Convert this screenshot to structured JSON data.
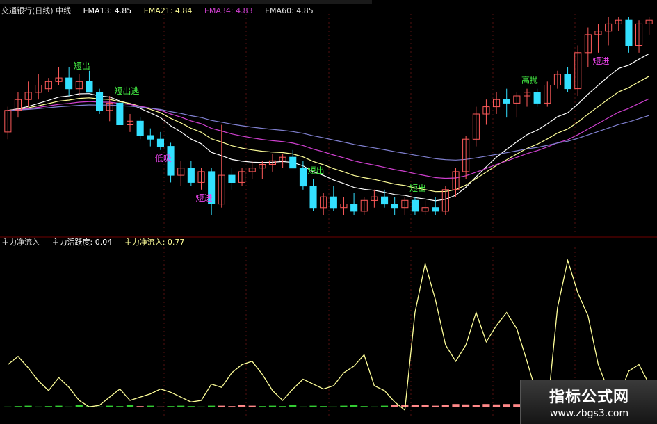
{
  "header": {
    "stock": "交通银行(日线)",
    "mode": "中线",
    "ema13": "EMA13: 4.85",
    "ema21": "EMA21: 4.84",
    "ema34": "EMA34: 4.83",
    "ema60": "EMA60: 4.85"
  },
  "indicator_header": {
    "name": "主力净流入",
    "activity": "主力活跃度: 0.04",
    "net_inflow": "主力净流入: 0.77"
  },
  "watermark": {
    "title": "指标公式网",
    "url": "www.zbgs3.com"
  },
  "colors": {
    "up": "#ff5a5a",
    "down": "#33e0ff",
    "ema13": "#ffffff",
    "ema21": "#ffff99",
    "ema34": "#d040d0",
    "ema60": "#8080d0",
    "flow": "#ffff99",
    "signal_green": "#44ee44",
    "signal_magenta": "#ee44ee"
  },
  "chart_data": [
    {
      "type": "candlestick",
      "title": "",
      "x_count": 64,
      "ylim": [
        4.6,
        5.2
      ],
      "candles": [
        [
          4.88,
          4.95,
          4.86,
          4.94
        ],
        [
          4.94,
          4.99,
          4.92,
          4.97
        ],
        [
          4.97,
          5.02,
          4.95,
          4.99
        ],
        [
          4.99,
          5.04,
          4.97,
          5.01
        ],
        [
          5.0,
          5.03,
          4.99,
          5.02
        ],
        [
          5.02,
          5.06,
          5.01,
          5.03
        ],
        [
          5.03,
          5.06,
          4.98,
          5.0
        ],
        [
          5.0,
          5.04,
          4.98,
          5.02
        ],
        [
          5.02,
          5.05,
          4.99,
          4.99
        ],
        [
          4.99,
          5.0,
          4.93,
          4.94
        ],
        [
          4.94,
          4.98,
          4.91,
          4.96
        ],
        [
          4.96,
          4.97,
          4.9,
          4.9
        ],
        [
          4.9,
          4.93,
          4.88,
          4.91
        ],
        [
          4.91,
          4.92,
          4.86,
          4.87
        ],
        [
          4.87,
          4.89,
          4.84,
          4.86
        ],
        [
          4.86,
          4.88,
          4.83,
          4.84
        ],
        [
          4.84,
          4.85,
          4.74,
          4.76
        ],
        [
          4.76,
          4.8,
          4.73,
          4.78
        ],
        [
          4.78,
          4.8,
          4.73,
          4.74
        ],
        [
          4.74,
          4.78,
          4.72,
          4.77
        ],
        [
          4.77,
          4.78,
          4.65,
          4.68
        ],
        [
          4.68,
          4.9,
          4.67,
          4.76
        ],
        [
          4.76,
          4.78,
          4.72,
          4.74
        ],
        [
          4.74,
          4.78,
          4.73,
          4.77
        ],
        [
          4.77,
          4.8,
          4.75,
          4.78
        ],
        [
          4.78,
          4.8,
          4.75,
          4.79
        ],
        [
          4.79,
          4.82,
          4.77,
          4.8
        ],
        [
          4.8,
          4.82,
          4.78,
          4.81
        ],
        [
          4.81,
          4.83,
          4.78,
          4.78
        ],
        [
          4.78,
          4.8,
          4.72,
          4.73
        ],
        [
          4.73,
          4.75,
          4.66,
          4.67
        ],
        [
          4.67,
          4.71,
          4.65,
          4.7
        ],
        [
          4.7,
          4.73,
          4.66,
          4.67
        ],
        [
          4.67,
          4.7,
          4.65,
          4.68
        ],
        [
          4.68,
          4.71,
          4.65,
          4.66
        ],
        [
          4.66,
          4.7,
          4.65,
          4.69
        ],
        [
          4.69,
          4.72,
          4.67,
          4.7
        ],
        [
          4.7,
          4.72,
          4.67,
          4.68
        ],
        [
          4.68,
          4.7,
          4.65,
          4.67
        ],
        [
          4.67,
          4.7,
          4.65,
          4.69
        ],
        [
          4.69,
          4.7,
          4.65,
          4.66
        ],
        [
          4.66,
          4.69,
          4.65,
          4.67
        ],
        [
          4.67,
          4.7,
          4.65,
          4.66
        ],
        [
          4.66,
          4.73,
          4.65,
          4.72
        ],
        [
          4.72,
          4.78,
          4.7,
          4.77
        ],
        [
          4.77,
          4.87,
          4.75,
          4.86
        ],
        [
          4.86,
          4.95,
          4.84,
          4.93
        ],
        [
          4.93,
          4.97,
          4.9,
          4.95
        ],
        [
          4.95,
          4.99,
          4.93,
          4.97
        ],
        [
          4.97,
          5.0,
          4.92,
          4.96
        ],
        [
          4.96,
          4.99,
          4.92,
          4.98
        ],
        [
          4.98,
          5.0,
          4.95,
          4.99
        ],
        [
          4.99,
          5.0,
          4.95,
          4.96
        ],
        [
          4.96,
          5.02,
          4.95,
          5.01
        ],
        [
          5.01,
          5.05,
          5.0,
          5.04
        ],
        [
          5.04,
          5.06,
          4.99,
          5.0
        ],
        [
          5.0,
          5.12,
          4.98,
          5.1
        ],
        [
          5.1,
          5.17,
          5.06,
          5.15
        ],
        [
          5.15,
          5.18,
          5.1,
          5.16
        ],
        [
          5.16,
          5.2,
          5.12,
          5.18
        ],
        [
          5.18,
          5.2,
          5.16,
          5.19
        ],
        [
          5.19,
          5.2,
          5.1,
          5.12
        ],
        [
          5.12,
          5.19,
          5.1,
          5.18
        ],
        [
          5.18,
          5.2,
          5.15,
          5.19
        ]
      ],
      "signals": [
        {
          "i": 7,
          "text": "短出",
          "kind": "sell"
        },
        {
          "i": 11,
          "text": "短出逃",
          "kind": "sell"
        },
        {
          "i": 15,
          "text": "低吸",
          "kind": "buy"
        },
        {
          "i": 19,
          "text": "短进",
          "kind": "buy"
        },
        {
          "i": 30,
          "text": "短出",
          "kind": "sell"
        },
        {
          "i": 40,
          "text": "短出",
          "kind": "sell"
        },
        {
          "i": 51,
          "text": "高抛",
          "kind": "sell"
        },
        {
          "i": 58,
          "text": "短进",
          "kind": "buy"
        }
      ]
    },
    {
      "type": "line",
      "title": "",
      "series": [
        {
          "values": [
            0.28,
            0.33,
            0.26,
            0.18,
            0.12,
            0.2,
            0.14,
            0.06,
            0.02,
            0.03,
            0.08,
            0.13,
            0.06,
            0.08,
            0.1,
            0.13,
            0.11,
            0.08,
            0.05,
            0.06,
            0.16,
            0.14,
            0.23,
            0.28,
            0.3,
            0.22,
            0.12,
            0.06,
            0.13,
            0.19,
            0.16,
            0.13,
            0.15,
            0.23,
            0.27,
            0.34,
            0.15,
            0.12,
            0.05,
            0.0,
            0.6,
            0.9,
            0.68,
            0.4,
            0.3,
            0.4,
            0.6,
            0.42,
            0.52,
            0.6,
            0.5,
            0.3,
            0.09,
            0.0,
            0.63,
            0.92,
            0.72,
            0.58,
            0.28,
            0.12,
            0.08,
            0.24,
            0.28,
            0.16
          ]
        }
      ],
      "ylim": [
        0,
        1
      ],
      "bars": [
        -0.2,
        -0.3,
        -0.4,
        -0.2,
        -0.3,
        -0.4,
        -0.2,
        -0.5,
        -0.3,
        -0.2,
        -0.4,
        -0.3,
        -0.5,
        0.3,
        -0.4,
        0.2,
        -0.3,
        -0.4,
        -0.3,
        -0.2,
        -0.4,
        0.4,
        0.3,
        0.5,
        0.4,
        -0.3,
        -0.4,
        -0.3,
        -0.5,
        -0.2,
        -0.4,
        -0.3,
        -0.2,
        -0.4,
        -0.5,
        -0.3,
        -0.2,
        -0.4,
        0.5,
        0.6,
        0.6,
        0.5,
        0.4,
        0.6,
        0.8,
        0.7,
        0.6,
        0.8,
        0.7,
        0.8,
        0.8,
        0.6,
        -0.3,
        0.5,
        0.8,
        0.9,
        0.7,
        0.8,
        0.9,
        0.8,
        0.7,
        0.7,
        0.8,
        0.6
      ]
    }
  ]
}
